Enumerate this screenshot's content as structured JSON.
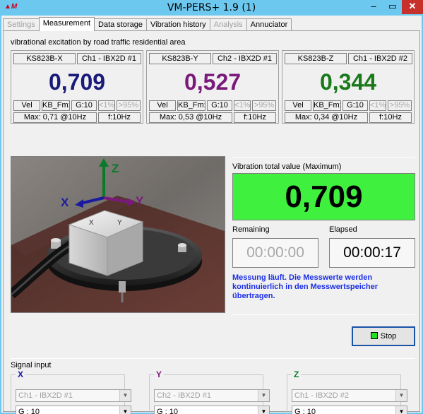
{
  "window": {
    "title": "VM-PERS+ 1.9 (1)",
    "minimize": "–",
    "maximize": "▭",
    "close": "✕"
  },
  "tabs": [
    {
      "label": "Settings",
      "state": "disabled"
    },
    {
      "label": "Measurement",
      "state": "active"
    },
    {
      "label": "Data storage",
      "state": "normal"
    },
    {
      "label": "Vibration history",
      "state": "normal"
    },
    {
      "label": "Analysis",
      "state": "disabled"
    },
    {
      "label": "Annuciator",
      "state": "normal"
    }
  ],
  "area_label": "vibrational excitation by road traffic residential area",
  "channels": [
    {
      "sensor": "KS823B-X",
      "channel": "Ch1 - IBX2D #1",
      "value": "0,709",
      "color": "#1a1a7a",
      "qty": "Vel",
      "filter": "KB_Fm:",
      "gain": "G:10",
      "lt": "<1%",
      "gt": ">95%",
      "max": "Max: 0,71 @10Hz",
      "freq": "f:10Hz"
    },
    {
      "sensor": "KS823B-Y",
      "channel": "Ch2 - IBX2D #1",
      "value": "0,527",
      "color": "#7a1a7a",
      "qty": "Vel",
      "filter": "KB_Fm:",
      "gain": "G:10",
      "lt": "<1%",
      "gt": ">95%",
      "max": "Max: 0,53 @10Hz",
      "freq": "f:10Hz"
    },
    {
      "sensor": "KS823B-Z",
      "channel": "Ch1 - IBX2D #2",
      "value": "0,344",
      "color": "#1a7a1a",
      "qty": "Vel",
      "filter": "KB_Fm:",
      "gain": "G:10",
      "lt": "<1%",
      "gt": ">95%",
      "max": "Max: 0,34 @10Hz",
      "freq": "f:10Hz"
    }
  ],
  "sensor_image": {
    "axis_x": "X",
    "axis_y": "Y",
    "axis_z": "Z",
    "x_color": "#1a1aa0",
    "y_color": "#7a1a7a",
    "z_color": "#0a7a2a"
  },
  "vibration_total": {
    "label": "Vibration total value (Maximum)",
    "value": "0,709",
    "color": "#3ff03f"
  },
  "remaining": {
    "label": "Remaining",
    "value": "00:00:00"
  },
  "elapsed": {
    "label": "Elapsed",
    "value": "00:00:17"
  },
  "status_message": "Messung läuft. Die Messwerte werden kontinuierlich in den Messwertspeicher übertragen.",
  "stop_button": {
    "label": "Stop"
  },
  "signal_input": {
    "label": "Signal input",
    "groups": [
      {
        "axis": "X",
        "color": "#1a1aa0",
        "channel": "Ch1 - IBX2D #1",
        "gain": "G :     10"
      },
      {
        "axis": "Y",
        "color": "#7a1a7a",
        "channel": "Ch2 - IBX2D #1",
        "gain": "G :     10"
      },
      {
        "axis": "Z",
        "color": "#0a7a2a",
        "channel": "Ch1 - IBX2D #2",
        "gain": "G :     10"
      }
    ]
  }
}
